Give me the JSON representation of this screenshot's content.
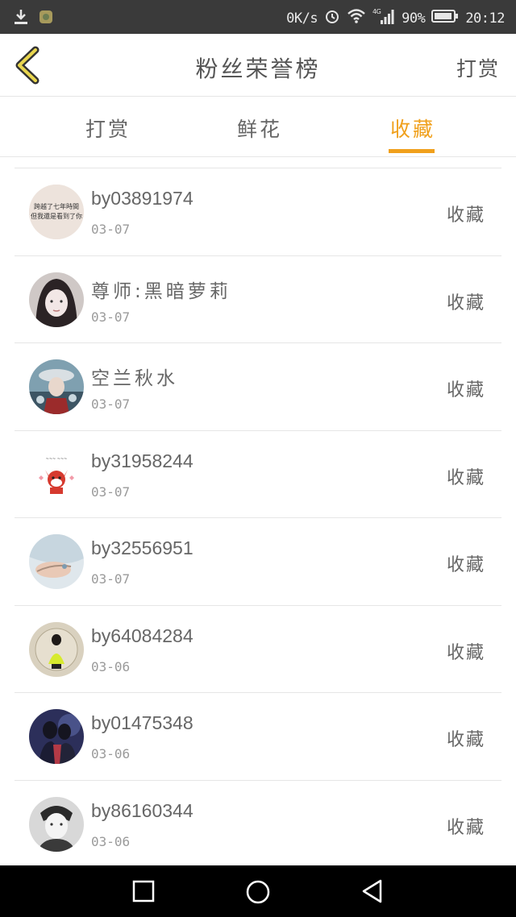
{
  "status_bar": {
    "net_speed": "0K/s",
    "network": "4G",
    "battery": "90%",
    "time": "20:12"
  },
  "header": {
    "title": "粉丝荣誉榜",
    "action": "打赏"
  },
  "tabs": [
    {
      "label": "打赏",
      "active": false
    },
    {
      "label": "鲜花",
      "active": false
    },
    {
      "label": "收藏",
      "active": true
    }
  ],
  "accent_color": "#f0a01c",
  "list": [
    {
      "name": "by03891974",
      "date": "03-07",
      "action": "收藏",
      "avatar_text": [
        "跨越了七年時間",
        "但我還是看到了你"
      ]
    },
    {
      "name": "尊师:黑暗萝莉",
      "date": "03-07",
      "action": "收藏"
    },
    {
      "name": "空兰秋水",
      "date": "03-07",
      "action": "收藏"
    },
    {
      "name": "by31958244",
      "date": "03-07",
      "action": "收藏"
    },
    {
      "name": "by32556951",
      "date": "03-07",
      "action": "收藏"
    },
    {
      "name": "by64084284",
      "date": "03-06",
      "action": "收藏"
    },
    {
      "name": "by01475348",
      "date": "03-06",
      "action": "收藏"
    },
    {
      "name": "by86160344",
      "date": "03-06",
      "action": "收藏"
    }
  ]
}
